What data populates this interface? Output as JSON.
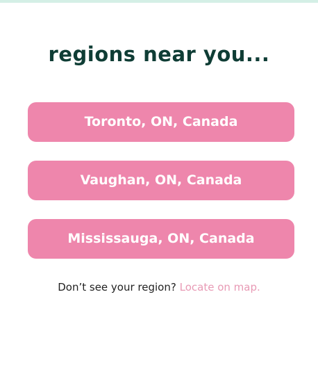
{
  "header": {
    "title": "regions near you..."
  },
  "regions": [
    {
      "label": "Toronto, ON, Canada"
    },
    {
      "label": "Vaughan, ON, Canada"
    },
    {
      "label": "Mississauga, ON, Canada"
    }
  ],
  "footer": {
    "prompt": "Don’t see your region?",
    "link_label": "Locate on map."
  },
  "colors": {
    "accent_strip": "#d4efe6",
    "title": "#0f3d35",
    "button_bg": "#ee86ac",
    "button_text": "#ffffff",
    "link": "#e89ab5"
  }
}
